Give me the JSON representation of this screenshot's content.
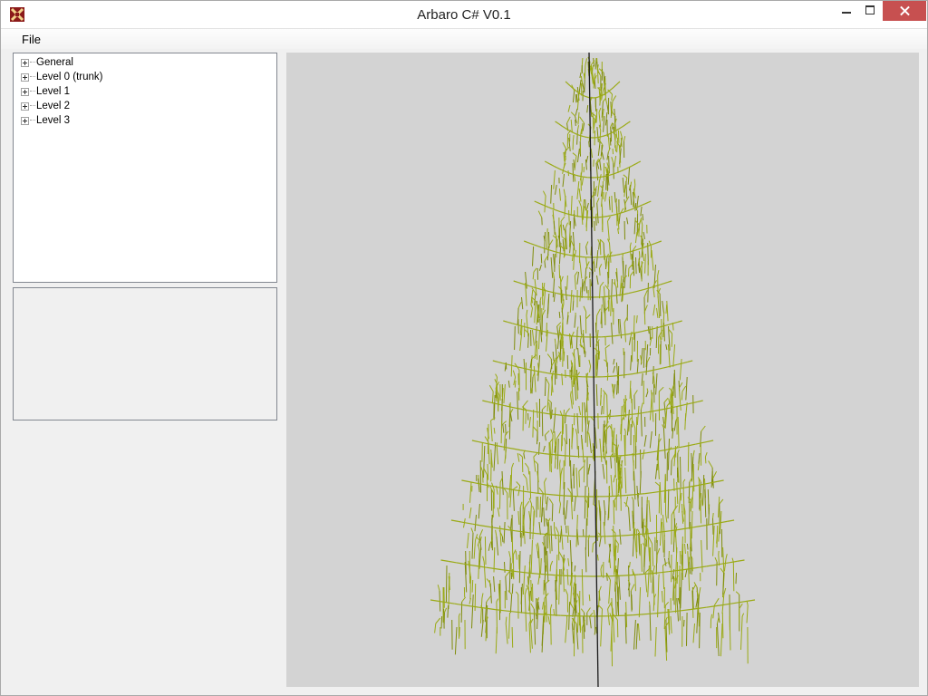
{
  "window": {
    "title": "Arbaro C# V0.1",
    "controls": {
      "minimize": "minimize",
      "maximize": "maximize",
      "close": "close"
    }
  },
  "menu": {
    "items": [
      {
        "label": "File"
      }
    ]
  },
  "tree": {
    "items": [
      {
        "label": "General",
        "icon": "plus-box-icon"
      },
      {
        "label": "Level 0 (trunk)",
        "icon": "plus-box-icon"
      },
      {
        "label": "Level 1",
        "icon": "plus-box-icon"
      },
      {
        "label": "Level 2",
        "icon": "plus-box-icon"
      },
      {
        "label": "Level 3",
        "icon": "plus-box-icon"
      }
    ]
  },
  "viewport": {
    "content": "tree-rendering",
    "colors": {
      "background": "#d3d3d3",
      "foliage": "#9aaa14",
      "foliage_dark": "#7f8c0a",
      "trunk": "#1a1a1a"
    }
  },
  "colors": {
    "close_button": "#c75050",
    "window_bg": "#f0f0f0"
  }
}
